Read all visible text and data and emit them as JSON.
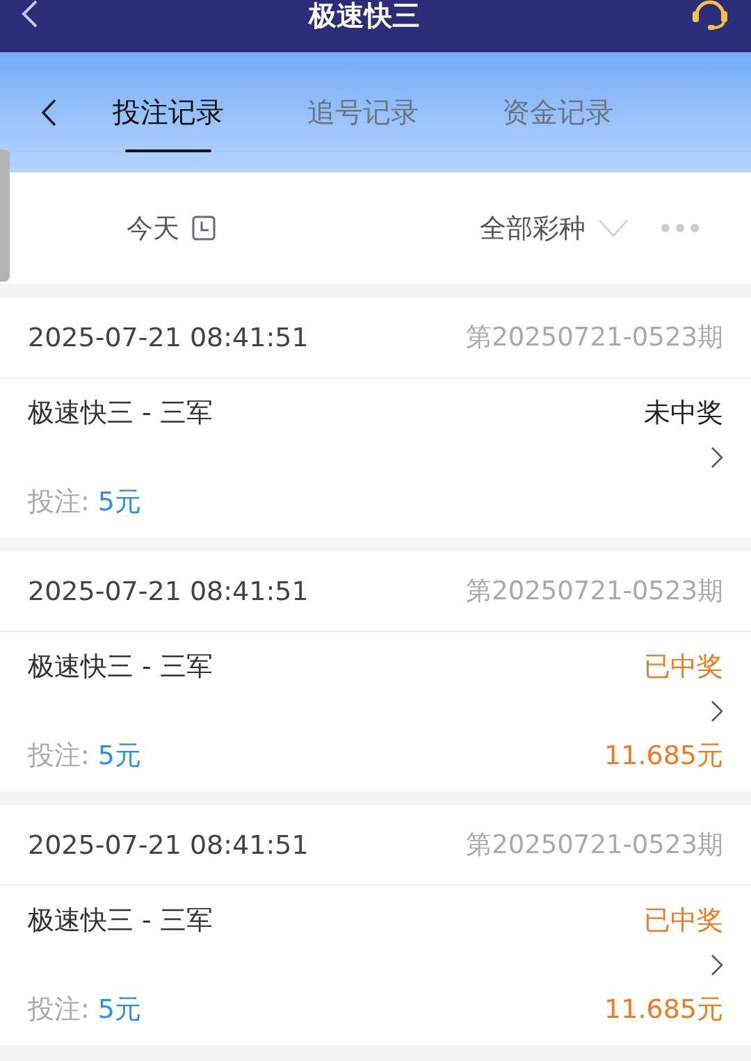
{
  "header": {
    "title": "极速快三"
  },
  "tabs": [
    {
      "label": "投注记录",
      "selected": true
    },
    {
      "label": "追号记录",
      "selected": false
    },
    {
      "label": "资金记录",
      "selected": false
    }
  ],
  "filters": {
    "date": "今天",
    "lottery": "全部彩种"
  },
  "records": [
    {
      "time": "2025-07-21 08:41:51",
      "issue": "第20250721-0523期",
      "game": "极速快三 - 三军",
      "status": "未中奖",
      "kind": "lost",
      "bet_label": "投注:",
      "bet": "5元"
    },
    {
      "time": "2025-07-21 08:41:51",
      "issue": "第20250721-0523期",
      "game": "极速快三 - 三军",
      "status": "已中奖",
      "kind": "won",
      "bet_label": "投注:",
      "bet": "5元",
      "payout": "11.685元"
    },
    {
      "time": "2025-07-21 08:41:51",
      "issue": "第20250721-0523期",
      "game": "极速快三 - 三军",
      "status": "已中奖",
      "kind": "won",
      "bet_label": "投注:",
      "bet": "5元",
      "payout": "11.685元"
    }
  ]
}
